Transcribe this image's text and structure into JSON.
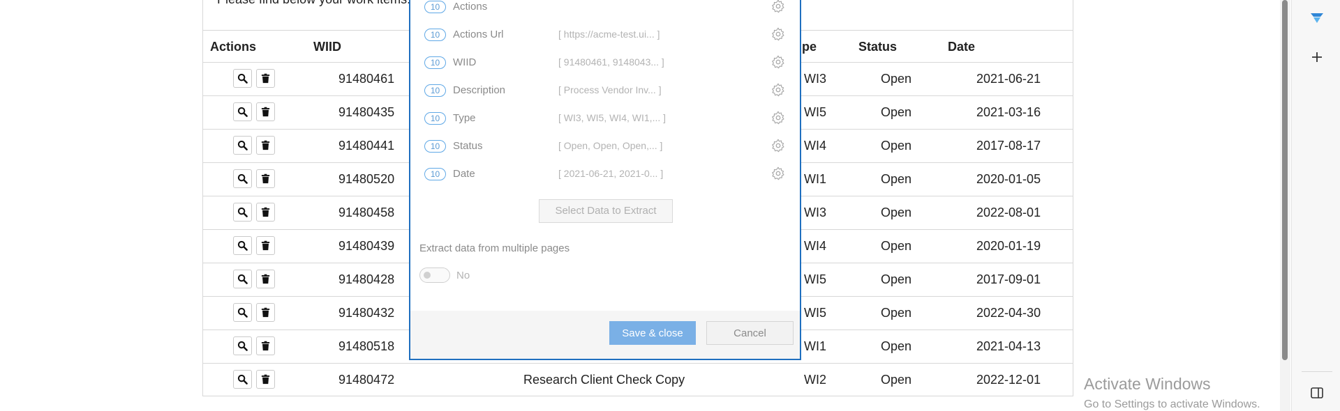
{
  "table": {
    "intro_text": "Please find below your work items.",
    "headers": {
      "actions": "Actions",
      "wiid": "WIID",
      "type": "pe",
      "status": "Status",
      "date": "Date"
    },
    "rows": [
      {
        "wiid": "91480461",
        "description": "",
        "type": "WI3",
        "status": "Open",
        "date": "2021-06-21"
      },
      {
        "wiid": "91480435",
        "description": "",
        "type": "WI5",
        "status": "Open",
        "date": "2021-03-16"
      },
      {
        "wiid": "91480441",
        "description": "",
        "type": "WI4",
        "status": "Open",
        "date": "2017-08-17"
      },
      {
        "wiid": "91480520",
        "description": "",
        "type": "WI1",
        "status": "Open",
        "date": "2020-01-05"
      },
      {
        "wiid": "91480458",
        "description": "",
        "type": "WI3",
        "status": "Open",
        "date": "2022-08-01"
      },
      {
        "wiid": "91480439",
        "description": "",
        "type": "WI4",
        "status": "Open",
        "date": "2020-01-19"
      },
      {
        "wiid": "91480428",
        "description": "",
        "type": "WI5",
        "status": "Open",
        "date": "2017-09-01"
      },
      {
        "wiid": "91480432",
        "description": "",
        "type": "WI5",
        "status": "Open",
        "date": "2022-04-30"
      },
      {
        "wiid": "91480518",
        "description": "",
        "type": "WI1",
        "status": "Open",
        "date": "2021-04-13"
      },
      {
        "wiid": "91480472",
        "description": "Research Client Check Copy",
        "type": "WI2",
        "status": "Open",
        "date": "2022-12-01"
      }
    ],
    "search_icon": "search-icon",
    "delete_icon": "trash-icon"
  },
  "modal": {
    "fields": [
      {
        "count": "10",
        "name": "Actions",
        "value": ""
      },
      {
        "count": "10",
        "name": "Actions Url",
        "value": "[ https://acme-test.ui... ]"
      },
      {
        "count": "10",
        "name": "WIID",
        "value": "[ 91480461, 9148043... ]"
      },
      {
        "count": "10",
        "name": "Description",
        "value": "[ Process Vendor Inv... ]"
      },
      {
        "count": "10",
        "name": "Type",
        "value": "[ WI3, WI5, WI4, WI1,... ]"
      },
      {
        "count": "10",
        "name": "Status",
        "value": "[ Open, Open, Open,... ]"
      },
      {
        "count": "10",
        "name": "Date",
        "value": "[ 2021-06-21, 2021-0... ]"
      }
    ],
    "select_button": "Select Data to Extract",
    "multi_page_label": "Extract data from multiple pages",
    "toggle_label": "No",
    "save_button": "Save & close",
    "cancel_button": "Cancel",
    "accent_color": "#1f6fbf"
  },
  "watermark": {
    "title": "Activate Windows",
    "subtitle": "Go to Settings to activate Windows."
  },
  "side_panel": {
    "top_icon": "app-logo-icon",
    "add_icon": "plus-icon",
    "bottom_icon": "sidebar-toggle-icon"
  }
}
